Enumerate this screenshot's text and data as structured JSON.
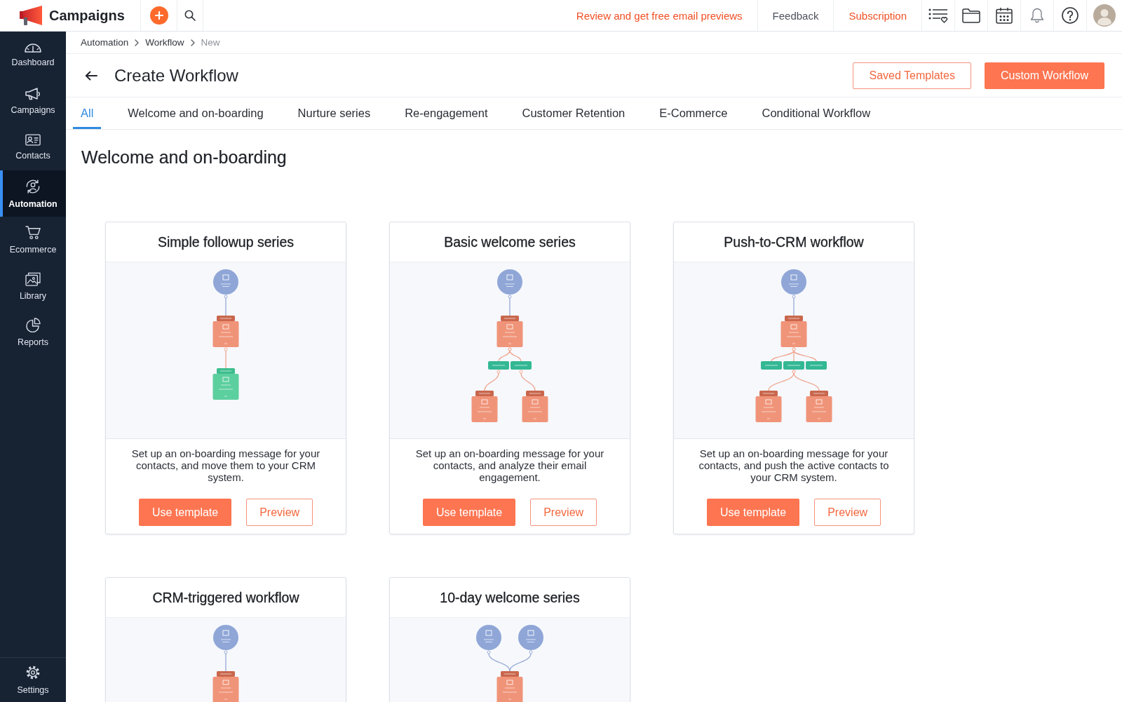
{
  "top_bar": {
    "app_name": "Campaigns",
    "links": [
      {
        "label": "Review and get free email previews",
        "kind": "promo"
      },
      {
        "label": "Feedback",
        "kind": "plain"
      },
      {
        "label": "Subscription",
        "kind": "promo"
      }
    ]
  },
  "sidebar": {
    "items": [
      {
        "label": "Dashboard",
        "selected": false
      },
      {
        "label": "Campaigns",
        "selected": false
      },
      {
        "label": "Contacts",
        "selected": false
      },
      {
        "label": "Automation",
        "selected": true
      },
      {
        "label": "Ecommerce",
        "selected": false
      },
      {
        "label": "Library",
        "selected": false
      },
      {
        "label": "Reports",
        "selected": false
      }
    ],
    "settings": {
      "label": "Settings",
      "selected": false
    }
  },
  "breadcrumb": [
    {
      "label": "Automation",
      "current": false
    },
    {
      "label": "Workflow",
      "current": false
    },
    {
      "label": "New",
      "current": true
    }
  ],
  "header": {
    "title": "Create Workflow",
    "buttons": [
      {
        "label": "Saved Templates",
        "kind": "outline"
      },
      {
        "label": "Custom Workflow",
        "kind": "primary"
      }
    ]
  },
  "tabs": [
    {
      "label": "All",
      "selected": true
    },
    {
      "label": "Welcome and on-boarding",
      "selected": false
    },
    {
      "label": "Nurture series",
      "selected": false
    },
    {
      "label": "Re-engagement",
      "selected": false
    },
    {
      "label": "Customer Retention",
      "selected": false
    },
    {
      "label": "E-Commerce",
      "selected": false
    },
    {
      "label": "Conditional Workflow",
      "selected": false
    }
  ],
  "section": {
    "title": "Welcome and on-boarding",
    "cards": [
      {
        "title": "Simple followup series",
        "preview_rows": [
          [
            {
              "kind": "trigger"
            }
          ],
          [
            {
              "kind": "email"
            }
          ],
          [
            {
              "kind": "action"
            }
          ]
        ],
        "description": "Set up an on-boarding message for your contacts, and move them to your CRM system.",
        "buttons": [
          {
            "label": "Use template",
            "kind": "primary"
          },
          {
            "label": "Preview",
            "kind": "outline"
          }
        ]
      },
      {
        "title": "Basic welcome series",
        "preview_rows": [
          [
            {
              "kind": "trigger"
            }
          ],
          [
            {
              "kind": "email"
            }
          ],
          [
            {
              "kind": "condition"
            },
            {
              "kind": "condition"
            }
          ],
          [
            {
              "kind": "email"
            },
            {
              "kind": "email"
            }
          ]
        ],
        "description": "Set up an on-boarding message for your contacts, and analyze their email engagement.",
        "buttons": [
          {
            "label": "Use template",
            "kind": "primary"
          },
          {
            "label": "Preview",
            "kind": "outline"
          }
        ]
      },
      {
        "title": "Push-to-CRM workflow",
        "preview_rows": [
          [
            {
              "kind": "trigger"
            }
          ],
          [
            {
              "kind": "email"
            }
          ],
          [
            {
              "kind": "condition"
            },
            {
              "kind": "condition"
            },
            {
              "kind": "condition"
            }
          ],
          [
            {
              "kind": "email"
            },
            {
              "kind": "email"
            }
          ]
        ],
        "description": "Set up an on-boarding message for your contacts, and push the active contacts to your CRM system.",
        "buttons": [
          {
            "label": "Use template",
            "kind": "primary"
          },
          {
            "label": "Preview",
            "kind": "outline"
          }
        ]
      },
      {
        "title": "CRM-triggered workflow",
        "preview_rows": [
          [
            {
              "kind": "trigger"
            }
          ],
          [
            {
              "kind": "email"
            }
          ]
        ]
      },
      {
        "title": "10-day welcome series",
        "preview_rows": [
          [
            {
              "kind": "trigger"
            },
            {
              "kind": "trigger"
            }
          ],
          [
            {
              "kind": "email"
            }
          ]
        ]
      }
    ]
  }
}
